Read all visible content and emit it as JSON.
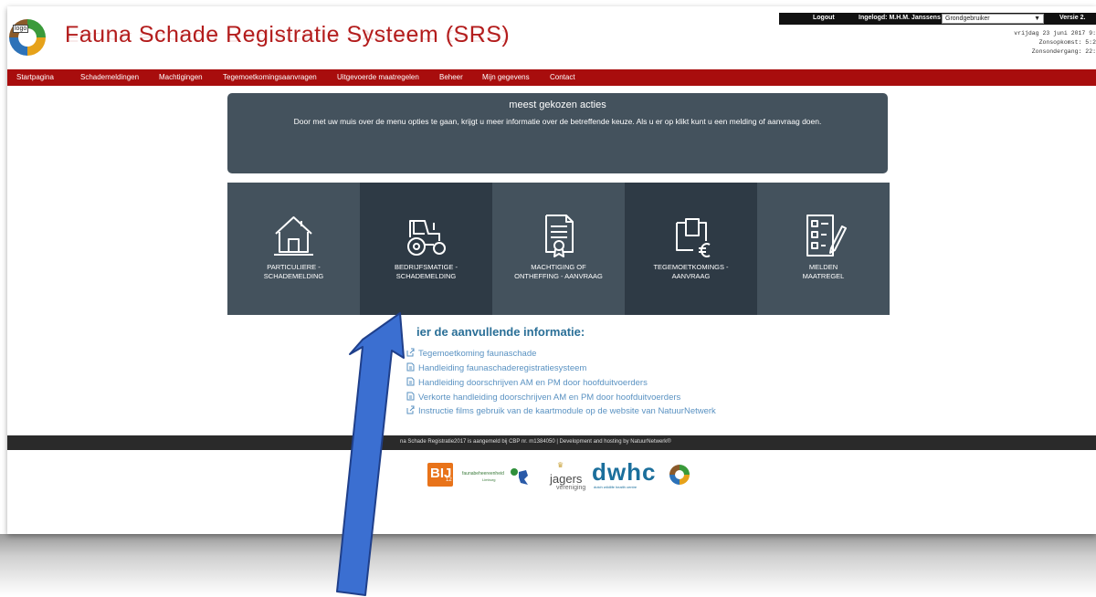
{
  "header": {
    "logo_label": "logo",
    "title": "Fauna Schade Registratie Systeem (SRS)",
    "logout": "Logout",
    "logged_in": "Ingelogd: M.H.M. Janssens",
    "role": "Grondgebruiker",
    "version": "Versie 2.",
    "date": "vrijdag 23 juni 2017 9:",
    "sunrise": "Zonsopkomst: 5:2",
    "sunset": "Zonsondergang: 22:"
  },
  "nav": [
    "Startpagina",
    "Schademeldingen",
    "Machtigingen",
    "Tegemoetkomingsaanvragen",
    "Uitgevoerde maatregelen",
    "Beheer",
    "Mijn gegevens",
    "Contact"
  ],
  "info": {
    "title": "meest gekozen acties",
    "text": "Door met uw muis over de menu opties te gaan, krijgt u meer informatie over de betreffende keuze. Als u er op klikt kunt u een melding of aanvraag doen."
  },
  "tiles": [
    {
      "line1": "PARTICULIERE -",
      "line2": "SCHADEMELDING",
      "icon": "house-icon",
      "color": "#44525d"
    },
    {
      "line1": "BEDRIJFSMATIGE -",
      "line2": "SCHADEMELDING",
      "icon": "tractor-icon",
      "color": "#2e3a45"
    },
    {
      "line1": "MACHTIGING OF",
      "line2": "ONTHEFFING - AANVRAAG",
      "icon": "certificate-icon",
      "color": "#44525d"
    },
    {
      "line1": "TEGEMOETKOMINGS -",
      "line2": "AANVRAAG",
      "icon": "wallet-euro-icon",
      "color": "#2e3a45"
    },
    {
      "line1": "MELDEN",
      "line2": "MAATREGEL",
      "icon": "checklist-icon",
      "color": "#44525d"
    }
  ],
  "links": {
    "heading": "ier de aanvullende informatie:",
    "items": [
      {
        "label": "Tegemoetkoming faunaschade",
        "icon": "external-link-icon"
      },
      {
        "label": "Handleiding faunaschaderegistratiesysteem",
        "icon": "document-icon"
      },
      {
        "label": "Handleiding doorschrijven AM en PM door hoofduitvoerders",
        "icon": "document-icon"
      },
      {
        "label": "Verkorte handleiding doorschrijven AM en PM door hoofduitvoerders",
        "icon": "document-icon"
      },
      {
        "label": "Instructie films gebruik van de kaartmodule op de website van NatuurNetwerk",
        "icon": "external-link-icon"
      }
    ]
  },
  "footer": {
    "text": "na Schade Registratie2017 is aangemeld bij CBP nr. m1384050 | Development and hosting by NatuurNetwerk®"
  },
  "partners": {
    "bij12": "BIJ",
    "bij12_sub": "12",
    "faunabeheer": "faunabeheereenheid",
    "faunabeheer_sub": "Limburg",
    "jagers": "jagers",
    "jagers_sub": "vereniging",
    "dwhc": "dwhc",
    "dwhc_sub": "dutch wildlife health centre"
  }
}
